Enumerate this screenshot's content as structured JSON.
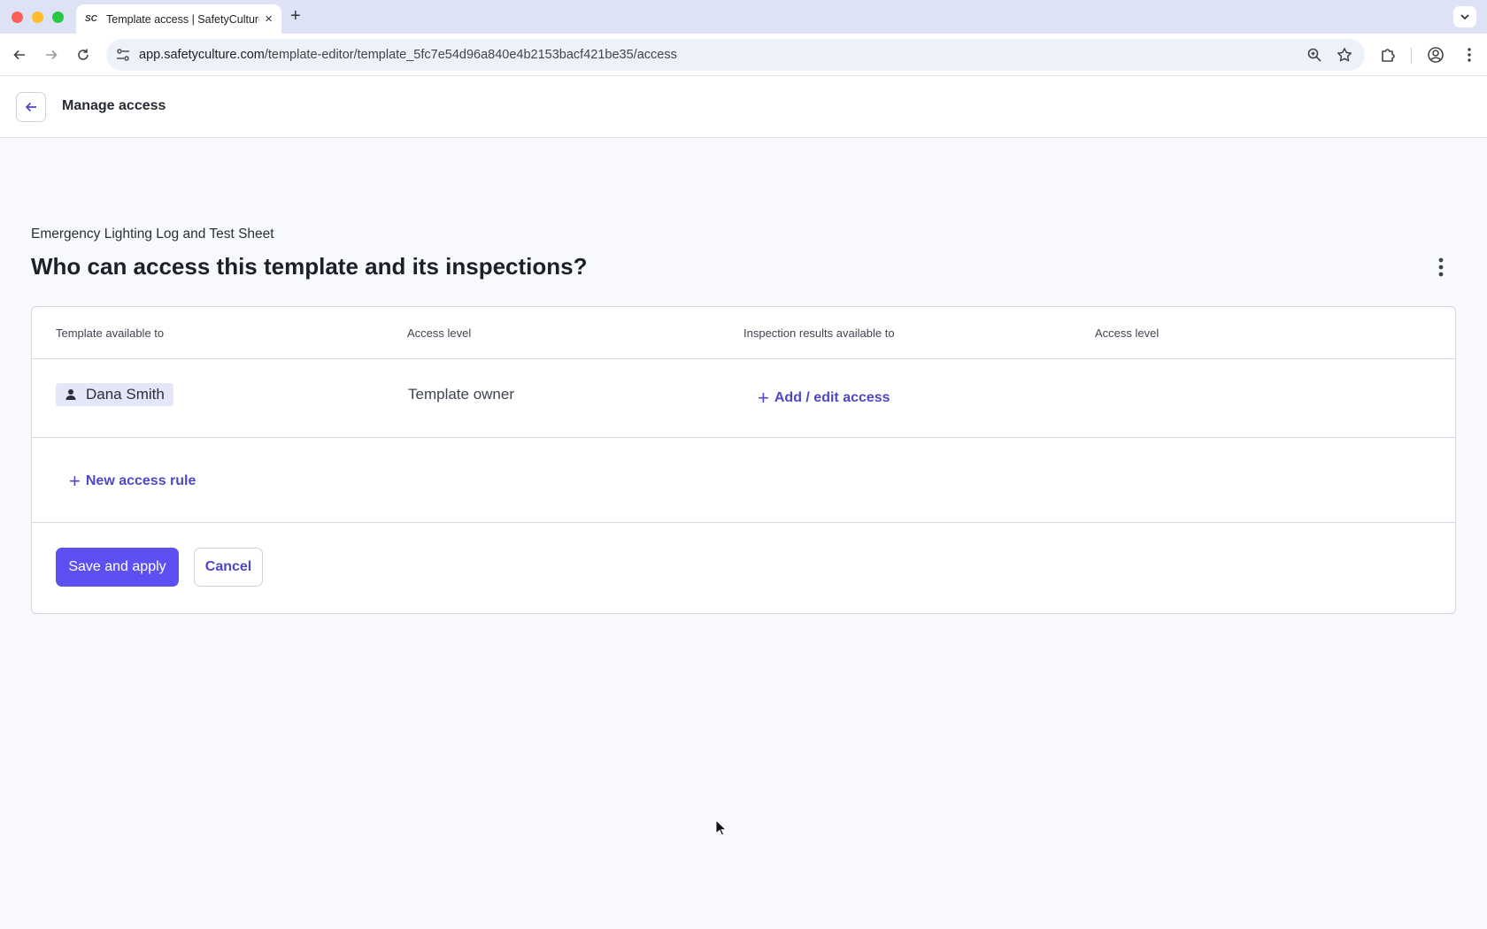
{
  "browser": {
    "tab": {
      "favicon": "SC",
      "title": "Template access | SafetyCulture",
      "close": "×"
    },
    "new_tab": "+",
    "url": {
      "host": "app.safetyculture.com",
      "path": "/template-editor/template_5fc7e54d96a840e4b2153bacf421be35/access"
    }
  },
  "header": {
    "title": "Manage access"
  },
  "page": {
    "template_name": "Emergency Lighting Log and Test Sheet",
    "heading": "Who can access this template and its inspections?"
  },
  "table": {
    "columns": [
      "Template available to",
      "Access level",
      "Inspection results available to",
      "Access level"
    ],
    "rows": [
      {
        "user": "Dana Smith",
        "access_level": "Template owner",
        "inspection_action": "Add / edit access"
      }
    ],
    "new_rule": "New access rule"
  },
  "actions": {
    "save": "Save and apply",
    "cancel": "Cancel"
  },
  "colors": {
    "primary": "#5c50f2",
    "link": "#4f46c8",
    "chip_bg": "#e4e6f9"
  }
}
